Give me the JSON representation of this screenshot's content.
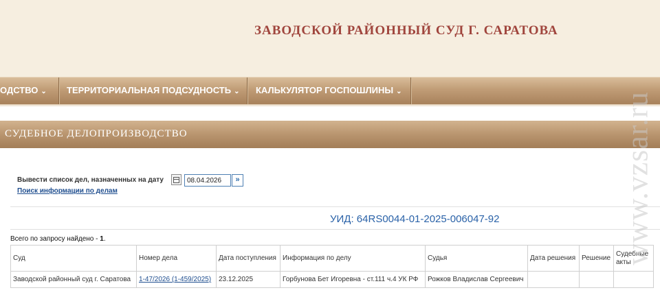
{
  "header": {
    "court_title": "ЗАВОДСКОЙ РАЙОННЫЙ СУД Г. САРАТОВА"
  },
  "nav": {
    "items": [
      {
        "label": "ОДСТВО",
        "icon": "chevron-down-icon"
      },
      {
        "label": "ТЕРРИТОРИАЛЬНАЯ ПОДСУДНОСТЬ",
        "icon": "chevron-down-icon"
      },
      {
        "label": "КАЛЬКУЛЯТОР ГОСПОШЛИНЫ",
        "icon": "chevron-down-icon"
      }
    ],
    "chevron": "⌄"
  },
  "section": {
    "title": "СУДЕБНОЕ ДЕЛОПРОИЗВОДСТВО"
  },
  "date_filter": {
    "label": "Вывести список дел, назначенных на дату",
    "date_value": "08.04.2026",
    "calendar_icon": "calendar-icon",
    "go_icon": "double-chevron-right-icon",
    "go_glyph": "»"
  },
  "search_link": "Поиск информации по делам",
  "uid": "УИД: 64RS0044-01-2025-006047-92",
  "results": {
    "found_label": "Всего по запросу найдено - ",
    "found_count": "1",
    "found_suffix": "."
  },
  "table": {
    "headers": [
      "Суд",
      "Номер дела",
      "Дата поступления",
      "Информация по делу",
      "Судья",
      "Дата решения",
      "Решение",
      "Судебные акты"
    ],
    "rows": [
      {
        "court": "Заводской районный суд г. Саратова",
        "case_number": "1-47/2026 (1-459/2025)",
        "received": "23.12.2025",
        "info": "Горбунова Бет Игоревна - ст.111 ч.4 УК РФ",
        "judge": "Рожков Владислав Сергеевич",
        "decision_date": "",
        "decision": "",
        "acts": ""
      }
    ]
  },
  "watermark": "www.vzsar.ru",
  "colors": {
    "title": "#a0453d",
    "nav_bg": "#b8946e",
    "link": "#1f4e8f",
    "uid": "#2a62a8"
  }
}
